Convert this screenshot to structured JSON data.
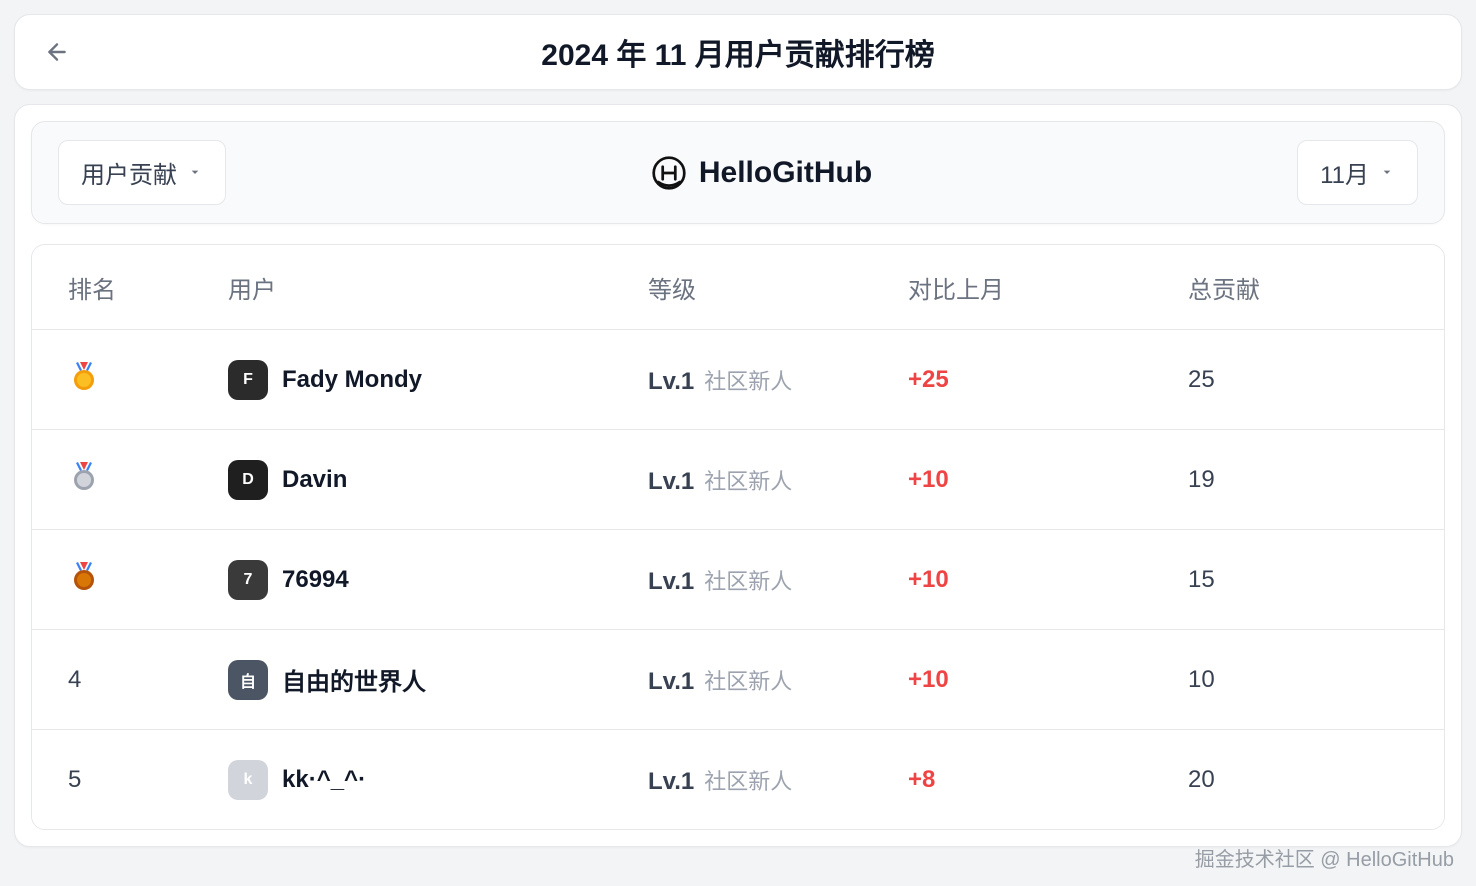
{
  "header": {
    "title": "2024 年 11 月用户贡献排行榜"
  },
  "filters": {
    "category_label": "用户贡献",
    "month_label": "11月"
  },
  "brand": {
    "name": "HelloGitHub"
  },
  "table": {
    "columns": {
      "rank": "排名",
      "user": "用户",
      "level": "等级",
      "delta": "对比上月",
      "total": "总贡献"
    },
    "rows": [
      {
        "rank": 1,
        "medal": "gold",
        "username": "Fady Mondy",
        "avatar_bg": "#2b2b2b",
        "level_num": "Lv.1",
        "level_label": "社区新人",
        "delta": "+25",
        "total": "25"
      },
      {
        "rank": 2,
        "medal": "silver",
        "username": "Davin",
        "avatar_bg": "#1f1f1f",
        "level_num": "Lv.1",
        "level_label": "社区新人",
        "delta": "+10",
        "total": "19"
      },
      {
        "rank": 3,
        "medal": "bronze",
        "username": "76994",
        "avatar_bg": "#3a3a3a",
        "level_num": "Lv.1",
        "level_label": "社区新人",
        "delta": "+10",
        "total": "15"
      },
      {
        "rank": 4,
        "medal": null,
        "username": "自由的世界人",
        "avatar_bg": "#4b5563",
        "level_num": "Lv.1",
        "level_label": "社区新人",
        "delta": "+10",
        "total": "10"
      },
      {
        "rank": 5,
        "medal": null,
        "username": "kk·^_^·",
        "avatar_bg": "#d1d5db",
        "level_num": "Lv.1",
        "level_label": "社区新人",
        "delta": "+8",
        "total": "20"
      }
    ]
  },
  "watermark": "掘金技术社区 @ HelloGitHub"
}
